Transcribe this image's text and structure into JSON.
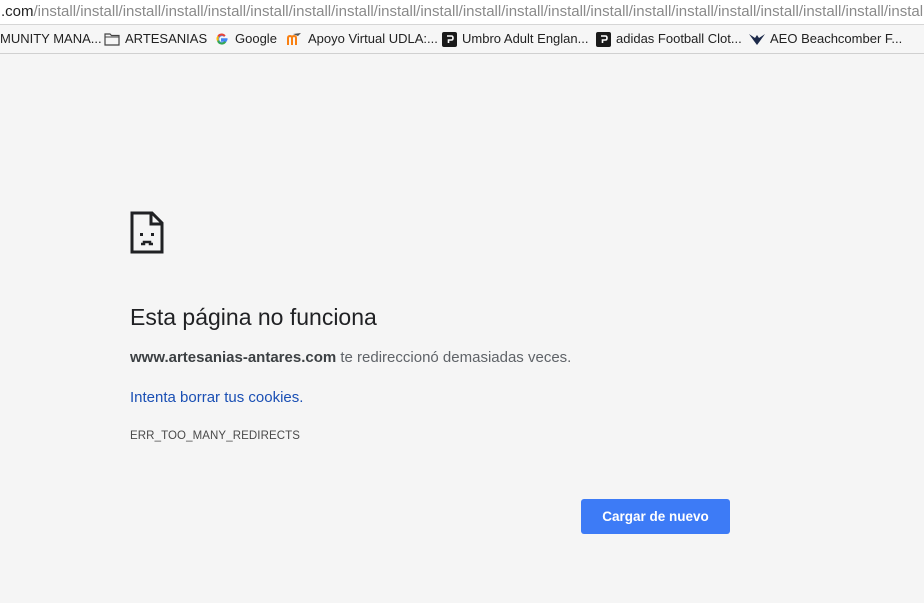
{
  "address_bar": {
    "host": ".com",
    "path": "/install/install/install/install/install/install/install/install/install/install/install/install/install/install/install/install/install/install/install/install/install/"
  },
  "bookmarks": [
    {
      "label": "MUNITY MANA...",
      "icon": "none"
    },
    {
      "label": "ARTESANIAS",
      "icon": "folder-icon"
    },
    {
      "label": "Google",
      "icon": "google-icon"
    },
    {
      "label": "Apoyo Virtual UDLA:...",
      "icon": "moodle-icon"
    },
    {
      "label": "Umbro Adult Englan...",
      "icon": "shop-icon"
    },
    {
      "label": "adidas Football Clot...",
      "icon": "shop-icon"
    },
    {
      "label": "AEO Beachcomber F...",
      "icon": "eagle-icon"
    }
  ],
  "error": {
    "title": "Esta página no funciona",
    "domain": "www.artesanias-antares.com",
    "message": " te redireccionó demasiadas veces.",
    "link": "Intenta borrar tus cookies.",
    "code": "ERR_TOO_MANY_REDIRECTS",
    "reload_button": "Cargar de nuevo"
  },
  "colors": {
    "accent": "#3d7bf6",
    "link": "#1a4fb4",
    "background": "#f5f5f5"
  }
}
